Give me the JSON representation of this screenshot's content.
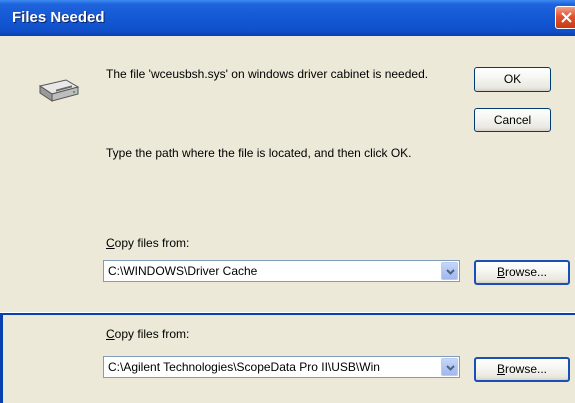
{
  "window": {
    "title": "Files Needed"
  },
  "message": "The file 'wceusbsh.sys' on windows driver cabinet is needed.",
  "instruction": "Type the path where the file is located, and then click OK.",
  "buttons": {
    "ok_label": "OK",
    "cancel_label": "Cancel"
  },
  "sections": [
    {
      "label_mnemonic": "C",
      "label_rest": "opy files from:",
      "path_value": "C:\\WINDOWS\\Driver Cache",
      "browse_mnemonic": "B",
      "browse_rest": "rowse..."
    },
    {
      "label_mnemonic": "C",
      "label_rest": "opy files from:",
      "path_value": "C:\\Agilent Technologies\\ScopeData Pro II\\USB\\Win",
      "browse_mnemonic": "B",
      "browse_rest": "rowse..."
    }
  ],
  "colors": {
    "titlebar": "#0f4fc9",
    "dialog_background": "#ece9d8",
    "close_button": "#e0532d"
  },
  "icons": [
    "disk-drive-icon",
    "close-icon",
    "chevron-down-icon"
  ]
}
